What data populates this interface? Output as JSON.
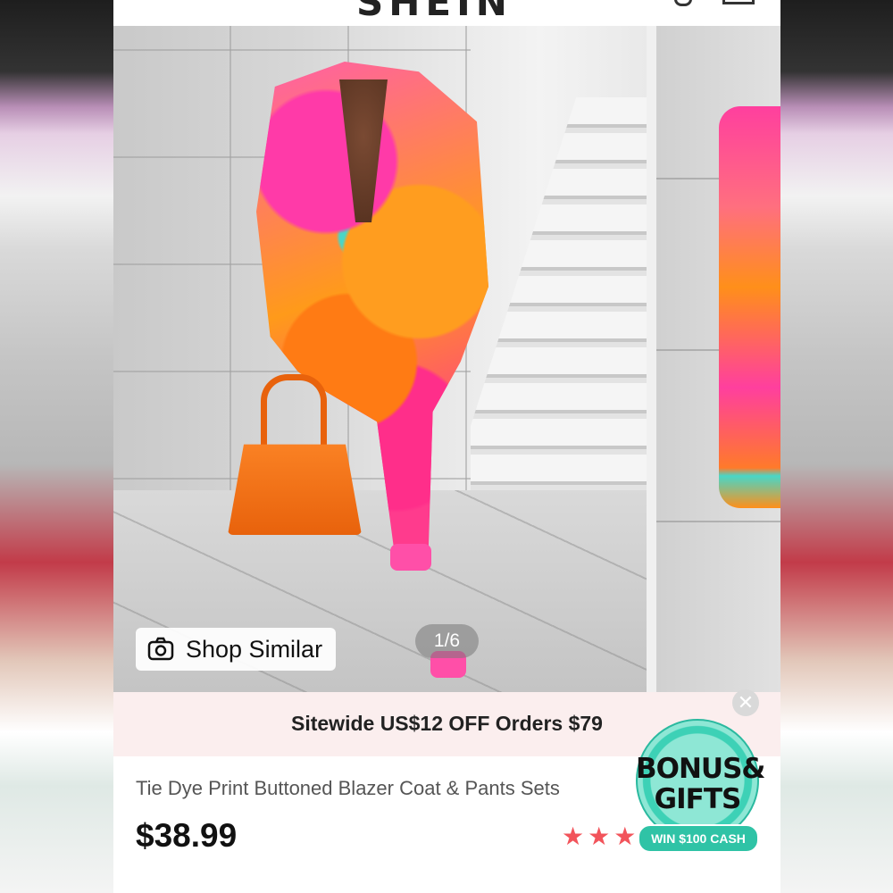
{
  "header": {
    "logo_text": "SHEIN"
  },
  "gallery": {
    "shop_similar_label": "Shop Similar",
    "pager": "1/6",
    "icons": {
      "camera": "camera-icon"
    }
  },
  "promo": {
    "text": "Sitewide US$12 OFF Orders $79",
    "close_symbol": "✕"
  },
  "product": {
    "title": "Tie Dye Print Buttoned Blazer Coat & Pants Sets",
    "price": "$38.99",
    "rating_stars": 3,
    "star_glyph": "★"
  },
  "bonus": {
    "line1": "BONUS&",
    "line2": "GIFTS",
    "ribbon": "WIN $100 CASH"
  },
  "colors": {
    "star": "#f2545b",
    "promo_bg": "#fbeeee",
    "bonus_teal": "#3dd1b6"
  }
}
